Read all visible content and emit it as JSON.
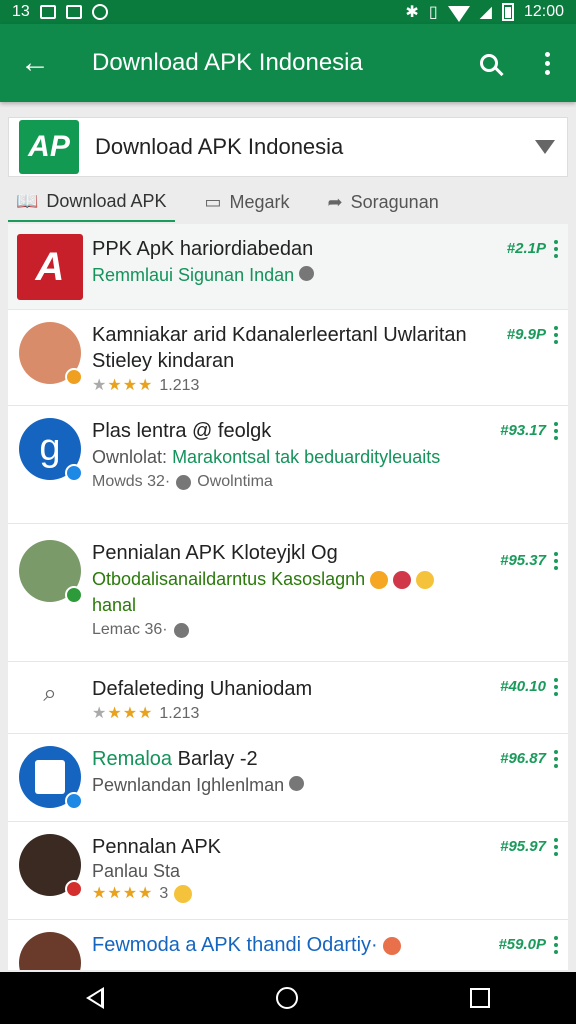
{
  "status_bar": {
    "left_text": "13",
    "time": "12:00",
    "icons": [
      "grid-icon",
      "image-icon",
      "alarm-icon",
      "bluetooth-icon",
      "vibrate-icon",
      "wifi-icon",
      "signal-icon",
      "battery-icon"
    ]
  },
  "app_bar": {
    "title": "Download APK Indonesia",
    "icons": [
      "back-arrow-icon",
      "search-icon",
      "more-vert-icon"
    ]
  },
  "selector": {
    "logo_text": "AP",
    "value": "Download APK Indonesia"
  },
  "tabs": [
    {
      "label": "Download APK",
      "icon": "book-icon",
      "active": true
    },
    {
      "label": "Megark",
      "icon": "chat-icon",
      "active": false
    },
    {
      "label": "Soragunan",
      "icon": "share-arrow-icon",
      "active": false
    }
  ],
  "items": [
    {
      "title": "PPK ApK hariordiabedan",
      "subtitle": "Remmlaui Sigunan Indan",
      "price": "#2.1P"
    },
    {
      "title": "Kamniakar arid Kdanalerleertanl Uwlaritan Stieley kindaran",
      "rating_text": "1.213",
      "price": "#9.9P"
    },
    {
      "title": "Plas lentra @ feolgk",
      "subtitle_prefix": "Ownlolat:",
      "subtitle": "Marakontsal tak beduardityleuaits",
      "meta_left": "Mowds 32·",
      "meta_right": "Owolntima",
      "price": "#93.17"
    },
    {
      "title": "Pennialan APK Kloteyjkl Og",
      "subtitle": "Otbodalisanaildarntus Kasoslagnh",
      "subtitle2": "hanal",
      "meta_left": "Lemac 36·",
      "price": "#95.37"
    },
    {
      "title": "Defaleteding Uhaniodam",
      "rating_text": "1.213",
      "price": "#40.10"
    },
    {
      "title_green": "Remaloa",
      "title": "Barlay -2",
      "subtitle": "Pewnlandan Ighlenlman",
      "price": "#96.87"
    },
    {
      "title": "Pennalan APK",
      "subtitle": "Panlau Sta",
      "rating_text": "3",
      "price": "#95.97"
    },
    {
      "title": "Fewmoda a APK thandi Odartiy·",
      "price": "#59.0P"
    }
  ],
  "colors": {
    "status_bar": "#0a7a3d",
    "app_bar": "#0f8a4a",
    "accent": "#1a9b5b",
    "star": "#e8a21e"
  }
}
